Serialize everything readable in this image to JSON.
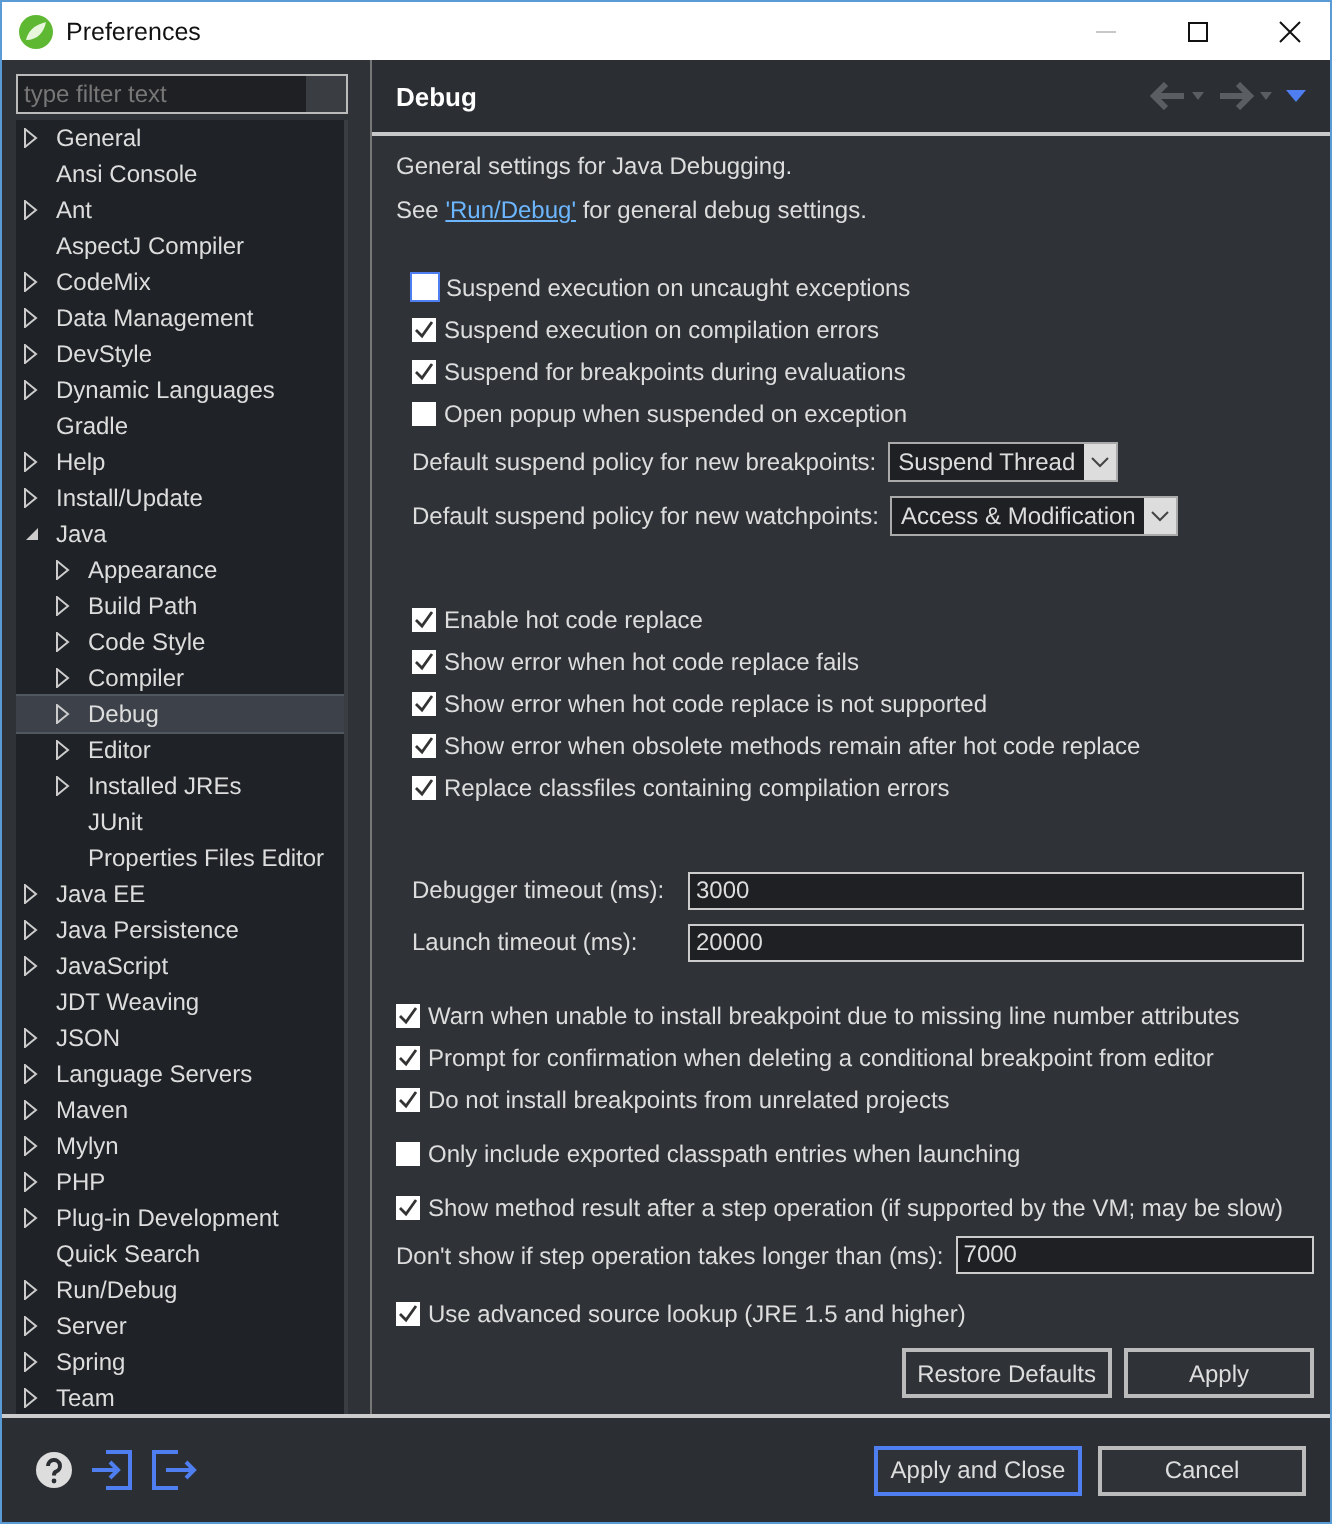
{
  "window": {
    "title": "Preferences"
  },
  "filter": {
    "placeholder": "type filter text"
  },
  "tree": [
    {
      "kind": "folder",
      "label": "General",
      "expanded": false,
      "selected": false
    },
    {
      "kind": "leaf",
      "label": "Ansi Console",
      "selected": false
    },
    {
      "kind": "folder",
      "label": "Ant",
      "expanded": false,
      "selected": false
    },
    {
      "kind": "leaf",
      "label": "AspectJ Compiler",
      "selected": false
    },
    {
      "kind": "folder",
      "label": "CodeMix",
      "expanded": false,
      "selected": false
    },
    {
      "kind": "folder",
      "label": "Data Management",
      "expanded": false,
      "selected": false
    },
    {
      "kind": "folder",
      "label": "DevStyle",
      "expanded": false,
      "selected": false
    },
    {
      "kind": "folder",
      "label": "Dynamic Languages",
      "expanded": false,
      "selected": false
    },
    {
      "kind": "leaf",
      "label": "Gradle",
      "selected": false
    },
    {
      "kind": "folder",
      "label": "Help",
      "expanded": false,
      "selected": false
    },
    {
      "kind": "folder",
      "label": "Install/Update",
      "expanded": false,
      "selected": false
    },
    {
      "kind": "folder",
      "label": "Java",
      "expanded": true,
      "selected": false,
      "children": [
        {
          "kind": "folder",
          "label": "Appearance",
          "expanded": false,
          "selected": false
        },
        {
          "kind": "folder",
          "label": "Build Path",
          "expanded": false,
          "selected": false
        },
        {
          "kind": "folder",
          "label": "Code Style",
          "expanded": false,
          "selected": false
        },
        {
          "kind": "folder",
          "label": "Compiler",
          "expanded": false,
          "selected": false
        },
        {
          "kind": "folder",
          "label": "Debug",
          "expanded": false,
          "selected": true
        },
        {
          "kind": "folder",
          "label": "Editor",
          "expanded": false,
          "selected": false
        },
        {
          "kind": "folder",
          "label": "Installed JREs",
          "expanded": false,
          "selected": false
        },
        {
          "kind": "leaf",
          "label": "JUnit",
          "selected": false
        },
        {
          "kind": "leaf",
          "label": "Properties Files Editor",
          "selected": false
        }
      ]
    },
    {
      "kind": "folder",
      "label": "Java EE",
      "expanded": false,
      "selected": false
    },
    {
      "kind": "folder",
      "label": "Java Persistence",
      "expanded": false,
      "selected": false
    },
    {
      "kind": "folder",
      "label": "JavaScript",
      "expanded": false,
      "selected": false
    },
    {
      "kind": "leaf",
      "label": "JDT Weaving",
      "selected": false
    },
    {
      "kind": "folder",
      "label": "JSON",
      "expanded": false,
      "selected": false
    },
    {
      "kind": "folder",
      "label": "Language Servers",
      "expanded": false,
      "selected": false
    },
    {
      "kind": "folder",
      "label": "Maven",
      "expanded": false,
      "selected": false
    },
    {
      "kind": "folder",
      "label": "Mylyn",
      "expanded": false,
      "selected": false
    },
    {
      "kind": "folder",
      "label": "PHP",
      "expanded": false,
      "selected": false
    },
    {
      "kind": "folder",
      "label": "Plug-in Development",
      "expanded": false,
      "selected": false
    },
    {
      "kind": "leaf",
      "label": "Quick Search",
      "selected": false
    },
    {
      "kind": "folder",
      "label": "Run/Debug",
      "expanded": false,
      "selected": false
    },
    {
      "kind": "folder",
      "label": "Server",
      "expanded": false,
      "selected": false
    },
    {
      "kind": "folder",
      "label": "Spring",
      "expanded": false,
      "selected": false
    },
    {
      "kind": "folder",
      "label": "Team",
      "expanded": false,
      "selected": false
    }
  ],
  "page": {
    "title": "Debug",
    "description": "General settings for Java Debugging.",
    "see_prefix": "See",
    "link": "'Run/Debug'",
    "see_suffix": "for general debug settings."
  },
  "groups": [
    {
      "items": [
        {
          "kind": "checkbox",
          "label": "Suspend execution on uncaught exceptions",
          "checked": false,
          "focused": true
        },
        {
          "kind": "checkbox",
          "label": "Suspend execution on compilation errors",
          "checked": true,
          "focused": false
        },
        {
          "kind": "checkbox",
          "label": "Suspend for breakpoints during evaluations",
          "checked": true,
          "focused": false
        },
        {
          "kind": "checkbox",
          "label": "Open popup when suspended on exception",
          "checked": false,
          "focused": false
        },
        {
          "kind": "select",
          "label": "Default suspend policy for new breakpoints:",
          "value": "Suspend Thread"
        },
        {
          "kind": "select",
          "label": "Default suspend policy for new watchpoints:",
          "value": "Access & Modification"
        }
      ]
    },
    {
      "items": [
        {
          "kind": "checkbox",
          "label": "Enable hot code replace",
          "checked": true,
          "focused": false
        },
        {
          "kind": "checkbox",
          "label": "Show error when hot code replace fails",
          "checked": true,
          "focused": false
        },
        {
          "kind": "checkbox",
          "label": "Show error when hot code replace is not supported",
          "checked": true,
          "focused": false
        },
        {
          "kind": "checkbox",
          "label": "Show error when obsolete methods remain after hot code replace",
          "checked": true,
          "focused": false
        },
        {
          "kind": "checkbox",
          "label": "Replace classfiles containing compilation errors",
          "checked": true,
          "focused": false
        }
      ]
    },
    {
      "items": [
        {
          "kind": "field",
          "label": "Debugger timeout (ms):",
          "value": "3000"
        },
        {
          "kind": "field",
          "label": "Launch timeout (ms):",
          "value": "20000"
        }
      ]
    },
    {
      "items": [
        {
          "kind": "checkbox",
          "label": "Warn when unable to install breakpoint due to missing line number attributes",
          "checked": true,
          "focused": false
        },
        {
          "kind": "checkbox",
          "label": "Prompt for confirmation when deleting a conditional breakpoint from editor",
          "checked": true,
          "focused": false
        },
        {
          "kind": "checkbox",
          "label": "Do not install breakpoints from unrelated projects",
          "checked": true,
          "focused": false
        }
      ]
    },
    {
      "items": [
        {
          "kind": "checkbox",
          "label": "Only include exported classpath entries when launching",
          "checked": false,
          "focused": false
        }
      ]
    },
    {
      "items": [
        {
          "kind": "checkbox",
          "label": "Show method result after a step operation (if supported by the VM; may be slow)",
          "checked": true,
          "focused": false
        },
        {
          "kind": "field",
          "label": "Don't show if step operation takes longer than (ms):",
          "value": "7000"
        }
      ]
    },
    {
      "items": [
        {
          "kind": "checkbox",
          "label": "Use advanced source lookup (JRE 1.5 and higher)",
          "checked": true,
          "focused": false
        }
      ]
    }
  ],
  "page_buttons": [
    "Restore Defaults",
    "Apply"
  ],
  "dialog_buttons": [
    {
      "label": "Apply and Close",
      "default": true
    },
    {
      "label": "Cancel",
      "default": false
    }
  ]
}
